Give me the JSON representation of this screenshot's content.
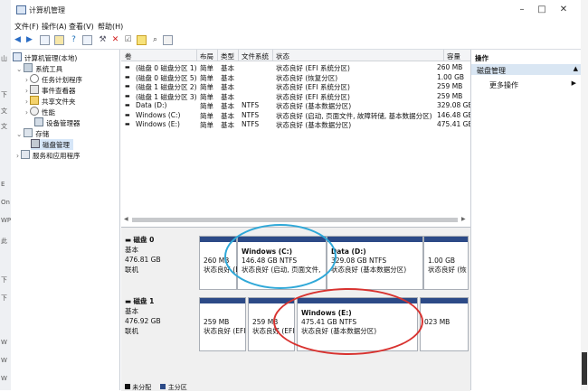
{
  "title": "计算机管理",
  "menu": [
    "文件(F)",
    "操作(A)",
    "查看(V)",
    "帮助(H)"
  ],
  "leftstrip": [
    "山",
    "下",
    "文",
    "文",
    "E",
    "On",
    "WP",
    "此",
    "下",
    "下",
    "W",
    "W",
    "W"
  ],
  "tree": {
    "root": "计算机管理(本地)",
    "system_tools": "系统工具",
    "task_scheduler": "任务计划程序",
    "event_viewer": "事件查看器",
    "shared_folders": "共享文件夹",
    "performance": "性能",
    "device_manager": "设备管理器",
    "storage": "存储",
    "disk_management": "磁盘管理",
    "services": "服务和应用程序"
  },
  "volumes": {
    "headers": [
      "卷",
      "布局",
      "类型",
      "文件系统",
      "状态",
      "容量"
    ],
    "rows": [
      [
        "(磁盘 0 磁盘分区 1)",
        "简单",
        "基本",
        "",
        "状态良好 (EFI 系统分区)",
        "260 MB"
      ],
      [
        "(磁盘 0 磁盘分区 5)",
        "简单",
        "基本",
        "",
        "状态良好 (恢复分区)",
        "1.00 GB"
      ],
      [
        "(磁盘 1 磁盘分区 2)",
        "简单",
        "基本",
        "",
        "状态良好 (EFI 系统分区)",
        "259 MB"
      ],
      [
        "(磁盘 1 磁盘分区 3)",
        "简单",
        "基本",
        "",
        "状态良好 (EFI 系统分区)",
        "259 MB"
      ],
      [
        "Data (D:)",
        "简单",
        "基本",
        "NTFS",
        "状态良好 (基本数据分区)",
        "329.08 GB"
      ],
      [
        "Windows (C:)",
        "简单",
        "基本",
        "NTFS",
        "状态良好 (启动, 页面文件, 故障转储, 基本数据分区)",
        "146.48 GB"
      ],
      [
        "Windows (E:)",
        "简单",
        "基本",
        "NTFS",
        "状态良好 (基本数据分区)",
        "475.41 GB"
      ]
    ]
  },
  "disk0": {
    "name": "磁盘 0",
    "type": "基本",
    "size": "476.81 GB",
    "state": "联机",
    "p1": {
      "size": "260 MB",
      "status": "状态良好 (EF"
    },
    "p2": {
      "name": "Windows (C:)",
      "size": "146.48 GB NTFS",
      "status": "状态良好 (启动, 页面文件,"
    },
    "p3": {
      "name": "Data (D:)",
      "size": "329.08 GB NTFS",
      "status": "状态良好 (基本数据分区)"
    },
    "p4": {
      "size": "1.00 GB",
      "status": "状态良好 (恢"
    }
  },
  "disk1": {
    "name": "磁盘 1",
    "type": "基本",
    "size": "476.92 GB",
    "state": "联机",
    "p1": {
      "size": "259 MB",
      "status": "状态良好 (EFI"
    },
    "p2": {
      "size": "259 MB",
      "status": "状态良好 (EFI"
    },
    "p3": {
      "name": "Windows (E:)",
      "size": "475.41 GB NTFS",
      "status": "状态良好 (基本数据分区)"
    },
    "p4": {
      "size": "023 MB",
      "status": ""
    }
  },
  "legend": [
    "未分配",
    "主分区"
  ],
  "actions": {
    "title": "操作",
    "selected": "磁盘管理",
    "more": "更多操作"
  },
  "colors": {
    "disk_bar": "#2c4a87",
    "circle_blue": "#2fa8d8",
    "circle_red": "#d8322f"
  }
}
